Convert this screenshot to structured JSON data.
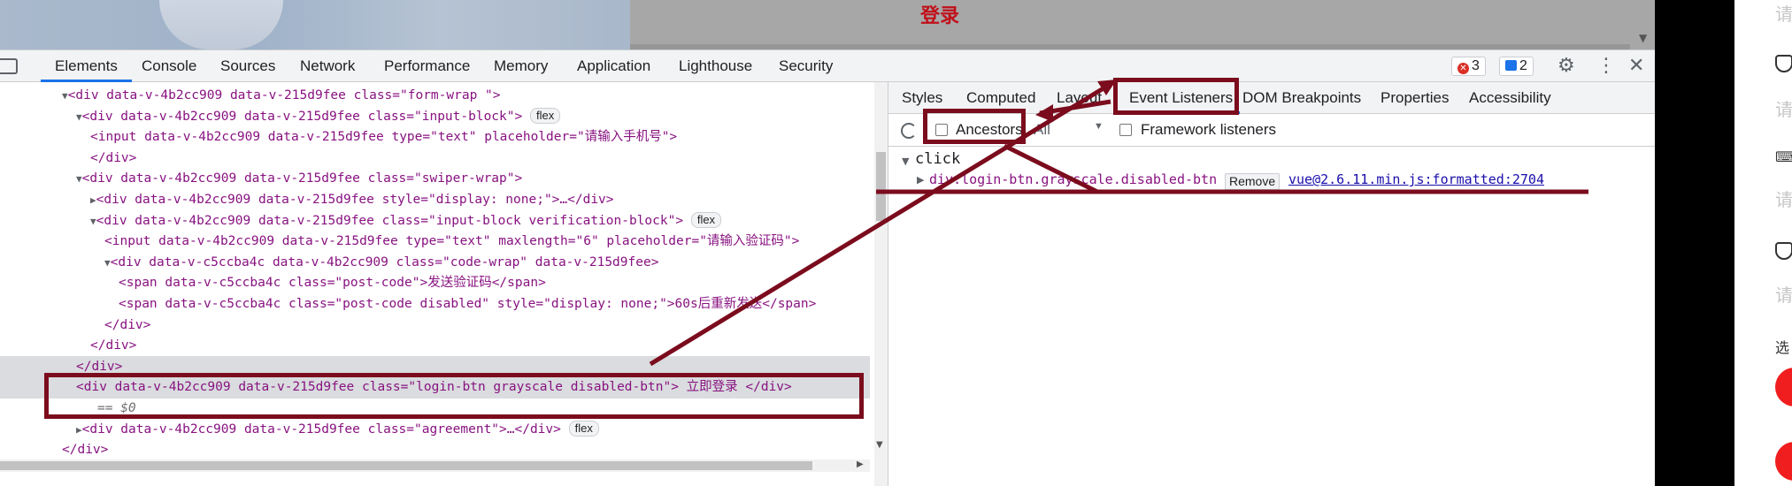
{
  "page": {
    "login_title": "登录",
    "right_strip": {
      "labels": [
        "请",
        "请",
        "请",
        "请",
        "选"
      ]
    }
  },
  "devtools": {
    "tabs": [
      "Elements",
      "Console",
      "Sources",
      "Network",
      "Performance",
      "Memory",
      "Application",
      "Lighthouse",
      "Security"
    ],
    "active_tab": "Elements",
    "error_count": "3",
    "message_count": "2",
    "settings_icon": "gear-icon",
    "more_icon": "kebab-icon",
    "close_icon": "close-icon"
  },
  "elements": {
    "lines": [
      {
        "indent": 0,
        "tri": "▼",
        "html": "<div data-v-4b2cc909 data-v-215d9fee class=\"form-wrap \">"
      },
      {
        "indent": 1,
        "tri": "▼",
        "html": "<div data-v-4b2cc909 data-v-215d9fee class=\"input-block\">",
        "pill": "flex"
      },
      {
        "indent": 2,
        "tri": "",
        "html": "<input data-v-4b2cc909 data-v-215d9fee type=\"text\" placeholder=\"请输入手机号\">"
      },
      {
        "indent": 2,
        "tri": "",
        "html": "</div>"
      },
      {
        "indent": 1,
        "tri": "▼",
        "html": "<div data-v-4b2cc909 data-v-215d9fee class=\"swiper-wrap\">"
      },
      {
        "indent": 2,
        "tri": "▶",
        "html": "<div data-v-4b2cc909 data-v-215d9fee style=\"display: none;\">…</div>"
      },
      {
        "indent": 2,
        "tri": "▼",
        "html": "<div data-v-4b2cc909 data-v-215d9fee class=\"input-block verification-block\">",
        "pill": "flex"
      },
      {
        "indent": 3,
        "tri": "",
        "html": "<input data-v-4b2cc909 data-v-215d9fee type=\"text\" maxlength=\"6\" placeholder=\"请输入验证码\">"
      },
      {
        "indent": 3,
        "tri": "▼",
        "html": "<div data-v-c5ccba4c data-v-4b2cc909 class=\"code-wrap\" data-v-215d9fee>"
      },
      {
        "indent": 4,
        "tri": "",
        "html": "<span data-v-c5ccba4c class=\"post-code\">发送验证码</span>"
      },
      {
        "indent": 4,
        "tri": "",
        "html": "<span data-v-c5ccba4c class=\"post-code disabled\" style=\"display: none;\">60s后重新发送</span>"
      },
      {
        "indent": 3,
        "tri": "",
        "html": "</div>"
      },
      {
        "indent": 2,
        "tri": "",
        "html": "</div>"
      },
      {
        "indent": 1,
        "tri": "",
        "html": "</div>"
      },
      {
        "indent": 1,
        "tri": "",
        "html": "<div data-v-4b2cc909 data-v-215d9fee class=\"login-btn grayscale disabled-btn\"> 立即登录 </div>"
      },
      {
        "indent": 1,
        "tri": "",
        "html": "== $0"
      },
      {
        "indent": 1,
        "tri": "▶",
        "html": "<div data-v-4b2cc909 data-v-215d9fee class=\"agreement\">…</div>",
        "pill": "flex"
      },
      {
        "indent": 0,
        "tri": "",
        "html": "</div>"
      }
    ]
  },
  "sidebar": {
    "tabs": [
      "Styles",
      "Computed",
      "Layout",
      "Event Listeners",
      "DOM Breakpoints",
      "Properties",
      "Accessibility"
    ],
    "active_tab": "Event Listeners",
    "ancestors_label": "Ancestors",
    "filter_value": "All",
    "framework_label": "Framework listeners",
    "event_type": "click",
    "listener_node": "div.login-btn.grayscale.disabled-btn",
    "remove_label": "Remove",
    "source_link": "vue@2.6.11.min.js:formatted:2704"
  }
}
